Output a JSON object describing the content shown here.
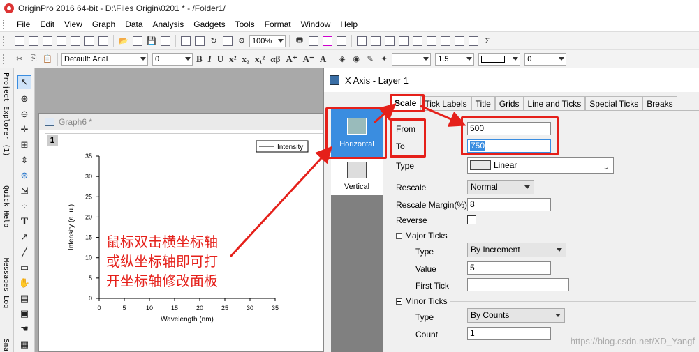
{
  "window": {
    "title": "OriginPro 2016 64-bit - D:\\Files Origin\\0201 * - /Folder1/"
  },
  "menu": [
    "File",
    "Edit",
    "View",
    "Graph",
    "Data",
    "Analysis",
    "Gadgets",
    "Tools",
    "Format",
    "Window",
    "Help"
  ],
  "toolbar1": {
    "zoom": "100%"
  },
  "toolbar2": {
    "font": "Default: Arial",
    "font_size": "0",
    "line_width": "1.5",
    "angle": "0",
    "bold": "B",
    "italic": "I",
    "underline": "U",
    "greek": "αβ"
  },
  "left_panels": [
    "Project Explorer (1)",
    "Quick Help",
    "Messages Log",
    "Sma"
  ],
  "graph": {
    "title": "Graph6 *",
    "layer": "1"
  },
  "chart_data": {
    "type": "line",
    "series": [
      {
        "name": "Intensity",
        "values": []
      }
    ],
    "xlabel": "Wavelength (nm)",
    "ylabel": "Intensity (a. u.)",
    "xticks": [
      0,
      5,
      10,
      15,
      20,
      25,
      30,
      35
    ],
    "yticks": [
      0,
      5,
      10,
      15,
      20,
      25,
      30,
      35
    ],
    "xlim": [
      0,
      35
    ],
    "ylim": [
      0,
      35
    ]
  },
  "annotation": {
    "line1": "鼠标双击横坐标轴",
    "line2": "或纵坐标轴即可打",
    "line3": "开坐标轴修改面板"
  },
  "dialog": {
    "title": "X Axis - Layer 1",
    "categories": [
      "Horizontal",
      "Vertical"
    ],
    "tabs": [
      "Scale",
      "Tick Labels",
      "Title",
      "Grids",
      "Line and Ticks",
      "Special Ticks",
      "Breaks"
    ],
    "from_label": "From",
    "from_value": "500",
    "to_label": "To",
    "to_value": "750",
    "type_label": "Type",
    "type_value": "Linear",
    "rescale_label": "Rescale",
    "rescale_value": "Normal",
    "margin_label": "Rescale Margin(%)",
    "margin_value": "8",
    "reverse_label": "Reverse",
    "major_label": "Major Ticks",
    "major_type_label": "Type",
    "major_type_value": "By Increment",
    "major_value_label": "Value",
    "major_value": "5",
    "first_tick_label": "First Tick",
    "first_tick_value": "",
    "minor_label": "Minor Ticks",
    "minor_type_label": "Type",
    "minor_type_value": "By Counts",
    "count_label": "Count",
    "count_value": "1"
  },
  "watermark": "https://blog.csdn.net/XD_Yangf",
  "colors": {
    "highlight": "#e5201a",
    "selected": "#3a8de0"
  }
}
